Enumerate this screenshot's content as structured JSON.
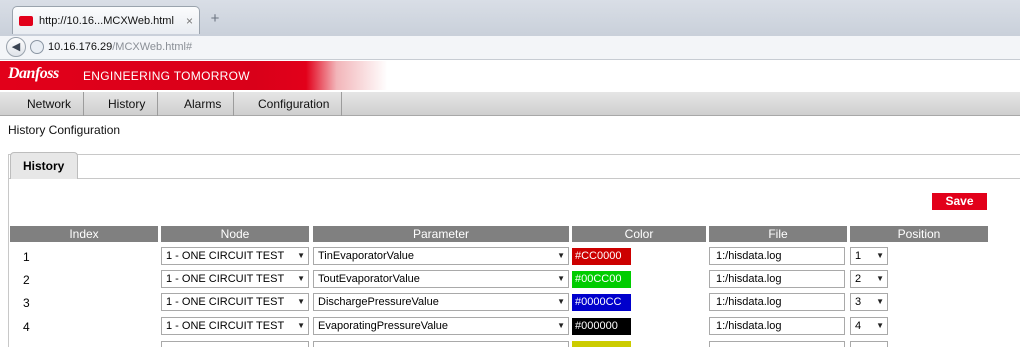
{
  "browser": {
    "tab_title": "http://10.16...MCXWeb.html",
    "tab_close": "×",
    "new_tab": "+",
    "url_host": "10.16.176.29",
    "url_path": "/MCXWeb.html#"
  },
  "brand": {
    "logo_text": "Danfoss",
    "tagline": "ENGINEERING TOMORROW",
    "accent": "#e2001a"
  },
  "menu": {
    "items": [
      "Network",
      "History",
      "Alarms",
      "Configuration"
    ]
  },
  "page": {
    "title": "History Configuration",
    "tab_label": "History",
    "save_label": "Save"
  },
  "table": {
    "headers": [
      "Index",
      "Node",
      "Parameter",
      "Color",
      "File",
      "Position"
    ],
    "rows": [
      {
        "index": "1",
        "node": "1 - ONE CIRCUIT TEST",
        "parameter": "TinEvaporatorValue",
        "color": "#CC0000",
        "file": "1:/hisdata.log",
        "position": "1"
      },
      {
        "index": "2",
        "node": "1 - ONE CIRCUIT TEST",
        "parameter": "ToutEvaporatorValue",
        "color": "#00CC00",
        "file": "1:/hisdata.log",
        "position": "2"
      },
      {
        "index": "3",
        "node": "1 - ONE CIRCUIT TEST",
        "parameter": "DischargePressureValue",
        "color": "#0000CC",
        "file": "1:/hisdata.log",
        "position": "3"
      },
      {
        "index": "4",
        "node": "1 - ONE CIRCUIT TEST",
        "parameter": "EvaporatingPressureValue",
        "color": "#000000",
        "file": "1:/hisdata.log",
        "position": "4"
      }
    ],
    "partial_row_color": "#CCCC00"
  }
}
